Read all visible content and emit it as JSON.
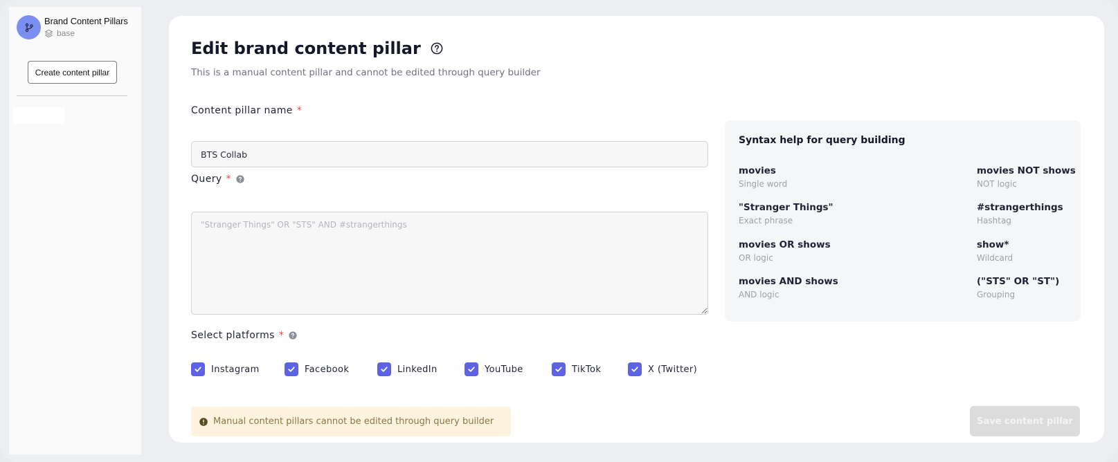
{
  "sidebar": {
    "brand_title": "Brand Content Pillars",
    "brand_sub": "base",
    "create_button": "Create content pillar"
  },
  "page": {
    "title": "Edit brand content pillar",
    "subtitle": "This is a manual content pillar and cannot be edited through query builder"
  },
  "form": {
    "name_label": "Content pillar name",
    "name_value": "BTS Collab",
    "query_label": "Query",
    "query_value": "",
    "query_placeholder": "\"Stranger Things\" OR \"STS\" AND #strangerthings",
    "platforms_label": "Select platforms",
    "required_mark": "*",
    "platforms": [
      {
        "label": "Instagram",
        "checked": true
      },
      {
        "label": "Facebook",
        "checked": true
      },
      {
        "label": "LinkedIn",
        "checked": true
      },
      {
        "label": "YouTube",
        "checked": true
      },
      {
        "label": "TikTok",
        "checked": true
      },
      {
        "label": "X (Twitter)",
        "checked": true
      }
    ]
  },
  "warning": "Manual content pillars cannot be edited through query builder",
  "save_button": "Save content pillar",
  "syntax": {
    "title": "Syntax help for query building",
    "items": [
      {
        "term": "movies",
        "desc": "Single word"
      },
      {
        "term": "movies NOT shows",
        "desc": "NOT logic"
      },
      {
        "term": "\"Stranger Things\"",
        "desc": "Exact phrase"
      },
      {
        "term": "#strangerthings",
        "desc": "Hashtag"
      },
      {
        "term": "movies OR shows",
        "desc": "OR logic"
      },
      {
        "term": "show*",
        "desc": "Wildcard"
      },
      {
        "term": "movies AND shows",
        "desc": "AND logic"
      },
      {
        "term": "(\"STS\" OR \"ST\")",
        "desc": "Grouping"
      }
    ]
  },
  "colors": {
    "accent": "#5e63e6",
    "avatar": "#7b8ff0",
    "required": "#e5484d",
    "warning_bg": "#fdf3df",
    "warning_text": "#8c7744"
  }
}
